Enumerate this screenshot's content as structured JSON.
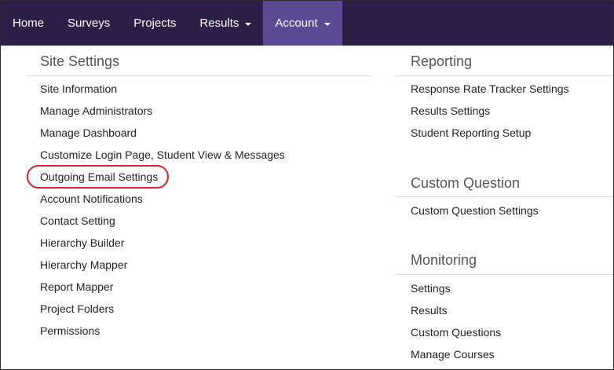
{
  "nav": {
    "items": [
      {
        "label": "Home"
      },
      {
        "label": "Surveys"
      },
      {
        "label": "Projects"
      },
      {
        "label": "Results"
      },
      {
        "label": "Account"
      }
    ]
  },
  "site_settings": {
    "title": "Site Settings",
    "items": [
      "Site Information",
      "Manage Administrators",
      "Manage Dashboard",
      "Customize Login Page, Student View & Messages",
      "Outgoing Email Settings",
      "Account Notifications",
      "Contact Setting",
      "Hierarchy Builder",
      "Hierarchy Mapper",
      "Report Mapper",
      "Project Folders",
      "Permissions"
    ]
  },
  "reporting": {
    "title": "Reporting",
    "items": [
      "Response Rate Tracker Settings",
      "Results Settings",
      "Student Reporting Setup"
    ]
  },
  "custom_question": {
    "title": "Custom Question",
    "items": [
      "Custom Question Settings"
    ]
  },
  "monitoring": {
    "title": "Monitoring",
    "items": [
      "Settings",
      "Results",
      "Custom Questions",
      "Manage Courses"
    ]
  },
  "colors": {
    "navbar": "#2c1f47",
    "nav_active": "#5a4a94",
    "highlight": "#d9202a"
  }
}
